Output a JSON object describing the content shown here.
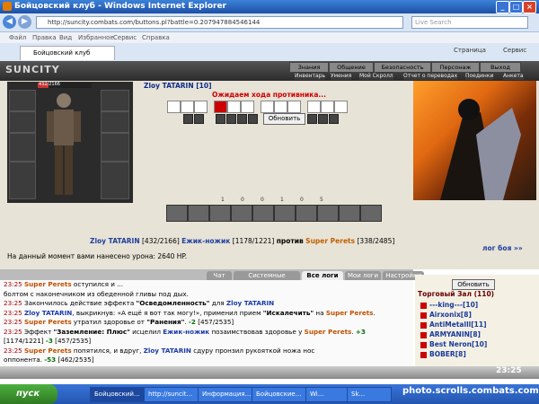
{
  "browser": {
    "title": "Бойцовский клуб - Windows Internet Explorer",
    "address": "http://suncity.combats.com/buttons.pl?battle=0.207947884546144",
    "search_placeholder": "Live Search",
    "menu": [
      "Файл",
      "Правка",
      "Вид",
      "Избранное",
      "Сервис",
      "Справка"
    ],
    "tab_label": "Бойцовский клуб",
    "toolbar": {
      "page": "Страница",
      "service": "Сервис"
    }
  },
  "game": {
    "logo": "SUNCITY",
    "top_menu": [
      "Знания",
      "Общение",
      "Безопасность",
      "Персонаж",
      "Выход"
    ],
    "sub_menu": [
      "Инвентарь",
      "Умения",
      "Мой Скролл",
      "Отчет о переводах",
      "Поединки",
      "Анкета"
    ],
    "hp": "432/2166",
    "fighter_name": "Zloy TATARIN [10]",
    "waiting": "Ожидаем хода противника...",
    "refresh": "Обновить",
    "stats": [
      "1",
      "0",
      "0",
      "1",
      "0",
      "5"
    ],
    "versus": {
      "p1": "Zloy TATARIN",
      "p1_hp": "[432/2166]",
      "p2": "Ежик-ножик",
      "p2_hp": "[1178/1221]",
      "vs": "против",
      "p3": "Super Perets",
      "p3_hp": "[338/2485]"
    },
    "log_link": "лог боя »»",
    "damage": "На данный момент вами нанесено урона: 2640 HP."
  },
  "chat": {
    "tabs": [
      "Чат",
      "Системные сообщения",
      "Все логи",
      "Мои логи",
      "Настройки"
    ],
    "active_tab": "Все логи",
    "lines": [
      [
        {
          "t": "23:25 ",
          "c": "time"
        },
        {
          "t": "Super Perets",
          "c": "op"
        },
        {
          "t": " оступился и ..."
        }
      ],
      [
        {
          "t": "болтом с наконечником из обеденной гливы под дых."
        }
      ],
      [
        {
          "t": "23:25 ",
          "c": "time"
        },
        {
          "t": "Закончилось действие эффекта "
        },
        {
          "t": "\"Осведомленность\"",
          "c": "hl"
        },
        {
          "t": " для "
        },
        {
          "t": "Zloy TATARIN",
          "c": "pl"
        }
      ],
      [
        {
          "t": "23:25 ",
          "c": "time"
        },
        {
          "t": "Zloy TATARIN",
          "c": "pl"
        },
        {
          "t": ", выкрикнув: «А ещё я вот так могу!», применил прием "
        },
        {
          "t": "\"Искалечить\"",
          "c": "hl"
        },
        {
          "t": " на "
        },
        {
          "t": "Super Perets",
          "c": "op"
        },
        {
          "t": "."
        }
      ],
      [
        {
          "t": "23:25 ",
          "c": "time"
        },
        {
          "t": "Super Perets",
          "c": "op"
        },
        {
          "t": " утратил здоровье от "
        },
        {
          "t": "\"Ранения\"",
          "c": "hl"
        },
        {
          "t": ". "
        },
        {
          "t": "-2",
          "c": "green"
        },
        {
          "t": " [457/2535]"
        }
      ],
      [
        {
          "t": "23:25 ",
          "c": "time"
        },
        {
          "t": "Эффект "
        },
        {
          "t": "\"Заземление: Плюс\"",
          "c": "hl"
        },
        {
          "t": " исцелил "
        },
        {
          "t": "Ежик-ножик",
          "c": "pl"
        },
        {
          "t": " позаимствовав здоровье у "
        },
        {
          "t": "Super Perets",
          "c": "op"
        },
        {
          "t": ". "
        },
        {
          "t": "+3",
          "c": "green"
        }
      ],
      [
        {
          "t": "[1174/1221] "
        },
        {
          "t": "-3",
          "c": "green"
        },
        {
          "t": " [457/2535]"
        }
      ],
      [
        {
          "t": "23:25 ",
          "c": "time"
        },
        {
          "t": "Super Perets",
          "c": "op"
        },
        {
          "t": " попятился, и вдруг, "
        },
        {
          "t": "Zloy TATARIN",
          "c": "pl"
        },
        {
          "t": " сдуру пронзил рукояткой ножа нос"
        }
      ],
      [
        {
          "t": "оппонента. "
        },
        {
          "t": "-53",
          "c": "green"
        },
        {
          "t": " [462/2535]"
        }
      ],
      [
        {
          "t": "23:25 ",
          "c": "time"
        },
        {
          "t": "Super Perets",
          "c": "op"
        },
        {
          "t": " задумался, но в это время "
        },
        {
          "t": "Zloy TATARIN",
          "c": "pl"
        },
        {
          "t": " робко уколол ножом в копчик врага. -"
        }
      ],
      [
        {
          "t": "86",
          "c": "green"
        },
        {
          "t": " [515/2535]"
        }
      ]
    ]
  },
  "hall": {
    "refresh": "Обновить",
    "title": "Торговый Зал (110)",
    "users": [
      "---king---[10]",
      "Airxonix[8]",
      "AntiMetalll[11]",
      "ARMYANIN[8]",
      "Best Neron[10]",
      "BOBER[8]"
    ]
  },
  "clock": "23:25",
  "taskbar": {
    "start": "пуск",
    "tasks": [
      "Бойцовский...",
      "http://suncit...",
      "Информация...",
      "Бойцовские...",
      "Wi...",
      "Sk..."
    ]
  },
  "watermark": "photo.scrolls.combats.com"
}
